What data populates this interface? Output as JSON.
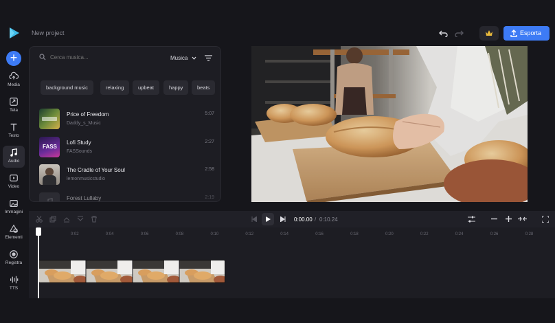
{
  "app": {
    "project_title": "New project",
    "export_label": "Esporta"
  },
  "sidebar": {
    "add_label": "+",
    "items": [
      {
        "label": "Media",
        "icon": "cloud-upload-icon"
      },
      {
        "label": "Tela",
        "icon": "canvas-resize-icon"
      },
      {
        "label": "Testo",
        "icon": "text-icon"
      },
      {
        "label": "Audio",
        "icon": "music-note-icon",
        "active": true
      },
      {
        "label": "Video",
        "icon": "video-icon"
      },
      {
        "label": "Immagini",
        "icon": "image-icon"
      },
      {
        "label": "Elementi",
        "icon": "shapes-icon"
      },
      {
        "label": "Registra",
        "icon": "record-icon"
      },
      {
        "label": "TTS",
        "icon": "waveform-icon"
      }
    ]
  },
  "music": {
    "search_placeholder": "Cerca musica...",
    "category_label": "Musica",
    "tags": [
      "background music",
      "relaxing",
      "upbeat",
      "happy",
      "beats"
    ],
    "tracks": [
      {
        "title": "Price of Freedom",
        "artist": "Daddy_s_Music",
        "duration": "5:07"
      },
      {
        "title": "Lofi Study",
        "artist": "FASSounds",
        "duration": "2:27"
      },
      {
        "title": "The Cradle of Your Soul",
        "artist": "lemonmusicstudio",
        "duration": "2:58"
      },
      {
        "title": "Forest Lullaby",
        "artist": "",
        "duration": "2:19"
      }
    ]
  },
  "player": {
    "current_time": "0:00.00",
    "separator": "/",
    "total_time": "0:10.24"
  },
  "timeline": {
    "ticks": [
      "0",
      "0:02",
      "0:04",
      "0:06",
      "0:08",
      "0:10",
      "0:12",
      "0:14",
      "0:16",
      "0:18",
      "0:20",
      "0:22",
      "0:24",
      "0:26",
      "0:28"
    ]
  },
  "colors": {
    "accent": "#3d7bf5",
    "background": "#16161b",
    "panel": "#1d1d23"
  }
}
